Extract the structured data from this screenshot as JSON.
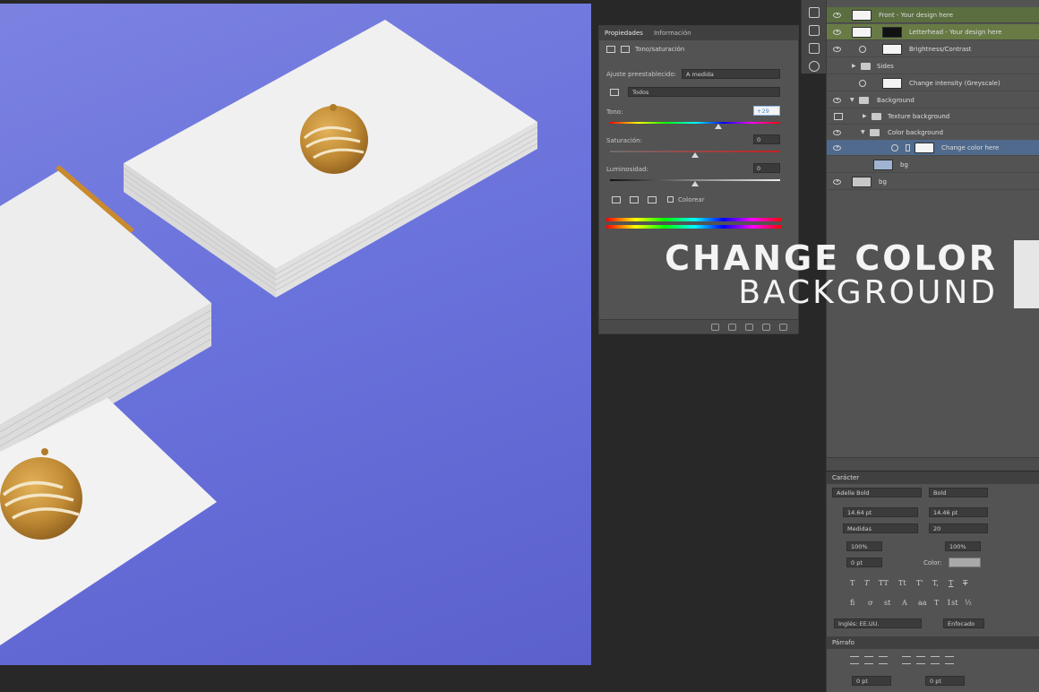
{
  "headline": {
    "line1": "CHANGE COLOR",
    "line2": "BACKGROUND"
  },
  "properties_panel": {
    "tabs": [
      "Propiedades",
      "Información"
    ],
    "title": "Tono/saturación",
    "preset_label": "Ajuste preestablecido:",
    "preset_value": "A medida",
    "channel_value": "Todos",
    "hue_label": "Tono:",
    "hue_value": "+29",
    "saturation_label": "Saturación:",
    "saturation_value": "0",
    "lightness_label": "Luminosidad:",
    "lightness_value": "0",
    "colorize_label": "Colorear"
  },
  "layers": [
    {
      "name": "Front - Your design here",
      "style": "green"
    },
    {
      "name": "Letterhead - Your design here",
      "style": "green2"
    },
    {
      "name": "Brightness/Contrast",
      "style": "normal"
    },
    {
      "name": "Sides",
      "style": "normal"
    },
    {
      "name": "Change intensity (Greyscale)",
      "style": "normal"
    },
    {
      "name": "Background",
      "style": "normal"
    },
    {
      "name": "Texture background",
      "style": "normal"
    },
    {
      "name": "Color background",
      "style": "normal"
    },
    {
      "name": "Change color here",
      "style": "selected"
    },
    {
      "name": "bg",
      "style": "normal"
    },
    {
      "name": "bg",
      "style": "normal"
    }
  ],
  "character_panel": {
    "title": "Carácter",
    "font_family": "Adelle Bold",
    "font_style": "Bold",
    "font_size": "14.64 pt",
    "leading": "14.46 pt",
    "kerning": "Medidas",
    "tracking": "20",
    "vertical_scale": "100%",
    "horizontal_scale": "100%",
    "baseline_shift": "0 pt",
    "color_label": "Color:",
    "language": "Inglés: EE.UU.",
    "antialias": "Enfocado",
    "paragraph_title": "Párrafo",
    "indent_value": "0 pt"
  },
  "colors": {
    "canvas_background": "#6a72dc",
    "gold_logo": "#c08a34",
    "selected_layer": "#4f6a8c",
    "green_layer": "#5a6e3f"
  }
}
